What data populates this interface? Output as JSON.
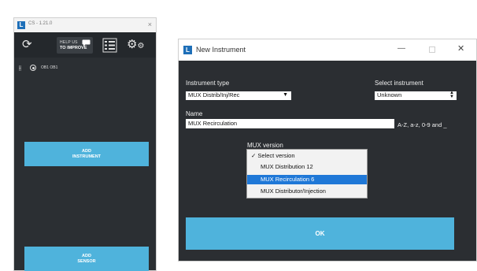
{
  "main_window": {
    "title": "CS - 1.21.0",
    "close_glyph": "×",
    "app_icon": "L",
    "toolbar": {
      "refresh_icon": "refresh-icon",
      "help_line1": "HELP US",
      "help_line2": "TO IMPROVE",
      "list_icon": "list-icon",
      "gear_icon": "gear-icon"
    },
    "instrument_label": "OB1 OB1",
    "add_instrument_line1": "ADD",
    "add_instrument_line2": "INSTRUMENT",
    "add_sensor_line1": "ADD",
    "add_sensor_line2": "SENSOR"
  },
  "dialog": {
    "app_icon": "L",
    "title": "New Instrument",
    "minimize_glyph": "—",
    "close_glyph": "✕",
    "instrument_type_label": "Instrument type",
    "instrument_type_value": "MUX Distrib/Inj/Rec",
    "select_instrument_label": "Select instrument",
    "select_instrument_value": "Unknown",
    "name_label": "Name",
    "name_value": "MUX Recirculation",
    "name_hint": "A-Z, a-z, 0-9 and _",
    "mux_version_label": "MUX version",
    "mux_options": [
      "Select version",
      "MUX Distribution 12",
      "MUX Recirculation 6",
      "MUX Distributor/Injection"
    ],
    "checked_option_mark": "✓",
    "selected_option_index": 2,
    "ok_label": "OK"
  },
  "colors": {
    "accent_cyan": "#4fb3dc",
    "dark_bg": "#2b2e32",
    "selection_blue": "#1f78d7",
    "brand_blue": "#1e6fb8"
  }
}
